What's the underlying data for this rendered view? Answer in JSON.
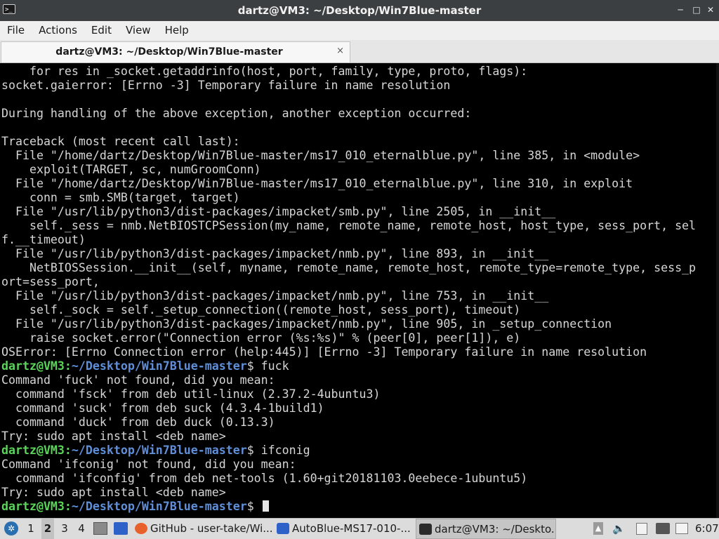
{
  "window": {
    "title": "dartz@VM3: ~/Desktop/Win7Blue-master",
    "app_icon": "terminal-icon",
    "app_icon_text": ">_",
    "minimize": "─",
    "maximize": "□",
    "close": "✕"
  },
  "menu": [
    "File",
    "Actions",
    "Edit",
    "View",
    "Help"
  ],
  "tab": {
    "label": "dartz@VM3: ~/Desktop/Win7Blue-master",
    "close": "×"
  },
  "terminal": {
    "lines": [
      {
        "type": "text",
        "text": "    for res in _socket.getaddrinfo(host, port, family, type, proto, flags):"
      },
      {
        "type": "text",
        "text": "socket.gaierror: [Errno -3] Temporary failure in name resolution"
      },
      {
        "type": "text",
        "text": ""
      },
      {
        "type": "text",
        "text": "During handling of the above exception, another exception occurred:"
      },
      {
        "type": "text",
        "text": ""
      },
      {
        "type": "text",
        "text": "Traceback (most recent call last):"
      },
      {
        "type": "text",
        "text": "  File \"/home/dartz/Desktop/Win7Blue-master/ms17_010_eternalblue.py\", line 385, in <module>"
      },
      {
        "type": "text",
        "text": "    exploit(TARGET, sc, numGroomConn)"
      },
      {
        "type": "text",
        "text": "  File \"/home/dartz/Desktop/Win7Blue-master/ms17_010_eternalblue.py\", line 310, in exploit"
      },
      {
        "type": "text",
        "text": "    conn = smb.SMB(target, target)"
      },
      {
        "type": "text",
        "text": "  File \"/usr/lib/python3/dist-packages/impacket/smb.py\", line 2505, in __init__"
      },
      {
        "type": "text",
        "text": "    self._sess = nmb.NetBIOSTCPSession(my_name, remote_name, remote_host, host_type, sess_port, sel"
      },
      {
        "type": "text",
        "text": "f.__timeout)"
      },
      {
        "type": "text",
        "text": "  File \"/usr/lib/python3/dist-packages/impacket/nmb.py\", line 893, in __init__"
      },
      {
        "type": "text",
        "text": "    NetBIOSSession.__init__(self, myname, remote_name, remote_host, remote_type=remote_type, sess_p"
      },
      {
        "type": "text",
        "text": "ort=sess_port,"
      },
      {
        "type": "text",
        "text": "  File \"/usr/lib/python3/dist-packages/impacket/nmb.py\", line 753, in __init__"
      },
      {
        "type": "text",
        "text": "    self._sock = self._setup_connection((remote_host, sess_port), timeout)"
      },
      {
        "type": "text",
        "text": "  File \"/usr/lib/python3/dist-packages/impacket/nmb.py\", line 905, in _setup_connection"
      },
      {
        "type": "text",
        "text": "    raise socket.error(\"Connection error (%s:%s)\" % (peer[0], peer[1]), e)"
      },
      {
        "type": "text",
        "text": "OSError: [Errno Connection error (help:445)] [Errno -3] Temporary failure in name resolution"
      },
      {
        "type": "prompt",
        "user": "dartz@VM3",
        "path": "~/Desktop/Win7Blue-master",
        "symbol": "$ ",
        "cmd": "fuck"
      },
      {
        "type": "text",
        "text": "Command 'fuck' not found, did you mean:"
      },
      {
        "type": "text",
        "text": "  command 'fsck' from deb util-linux (2.37.2-4ubuntu3)"
      },
      {
        "type": "text",
        "text": "  command 'suck' from deb suck (4.3.4-1build1)"
      },
      {
        "type": "text",
        "text": "  command 'duck' from deb duck (0.13.3)"
      },
      {
        "type": "text",
        "text": "Try: sudo apt install <deb name>"
      },
      {
        "type": "prompt",
        "user": "dartz@VM3",
        "path": "~/Desktop/Win7Blue-master",
        "symbol": "$ ",
        "cmd": "ifconig"
      },
      {
        "type": "text",
        "text": "Command 'ifconig' not found, did you mean:"
      },
      {
        "type": "text",
        "text": "  command 'ifconfig' from deb net-tools (1.60+git20181103.0eebece-1ubuntu5)"
      },
      {
        "type": "text",
        "text": "Try: sudo apt install <deb name>"
      },
      {
        "type": "prompt",
        "user": "dartz@VM3",
        "path": "~/Desktop/Win7Blue-master",
        "symbol": "$ ",
        "cmd": "",
        "cursor": true
      }
    ]
  },
  "taskbar": {
    "start_icon": "lxqt-start-icon",
    "workspaces": [
      "1",
      "2",
      "3",
      "4"
    ],
    "active_workspace": "2",
    "tasks": [
      {
        "icon": "firefox-icon",
        "label": "GitHub - user-take/Wi...",
        "color": "#e8612c"
      },
      {
        "icon": "window-icon",
        "label": "AutoBlue-MS17-010-...",
        "color": "#2f62c9"
      },
      {
        "icon": "terminal-icon",
        "label": "dartz@VM3: ~/Deskto...",
        "color": "#2b2b2b",
        "active": true
      }
    ],
    "tray": [
      "upload-icon",
      "volume-icon",
      "clipboard-icon",
      "network-icon",
      "notification-icon"
    ],
    "clock": "6:07"
  }
}
